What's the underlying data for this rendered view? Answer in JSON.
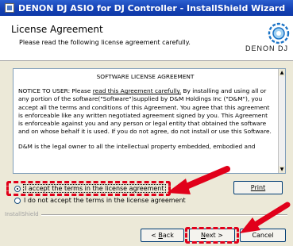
{
  "window": {
    "title": "DENON DJ ASIO for DJ Controller - InstallShield Wizard"
  },
  "header": {
    "title": "License Agreement",
    "subtitle": "Please read the following license agreement carefully.",
    "brand": "DENON DJ"
  },
  "license": {
    "heading": "SOFTWARE LICENSE AGREEMENT",
    "para1_pre": "NOTICE TO USER: Please ",
    "para1_link": "read this Agreement carefully.",
    "para1_post": " By installing and using all or any portion of the software(\"Software\")supplied by D&M Holdings Inc (\"D&M\"), you accept all the terms and conditions of this Agreement. You agree that this agreement is enforceable like any written negotiated agreement signed by you. This Agreement is enforceable against you and any person or legal entity that obtained the software and on whose behalf it is used. If you do not agree, do not install or use this Software.",
    "para2": "D&M is the legal owner to all the intellectual property embedded, embodied and"
  },
  "options": {
    "accept": "I accept the terms in the license agreement",
    "decline": "I do not accept the terms in the license agreement",
    "selected": "accept"
  },
  "footer": {
    "brand": "InstallShield"
  },
  "buttons": {
    "print": "Print",
    "back_pre": "< ",
    "back_ul": "B",
    "back_post": "ack",
    "next_ul": "N",
    "next_post": "ext >",
    "cancel": "Cancel"
  },
  "colors": {
    "annotation": "#e1001a",
    "title_bar": "#1541b3"
  }
}
